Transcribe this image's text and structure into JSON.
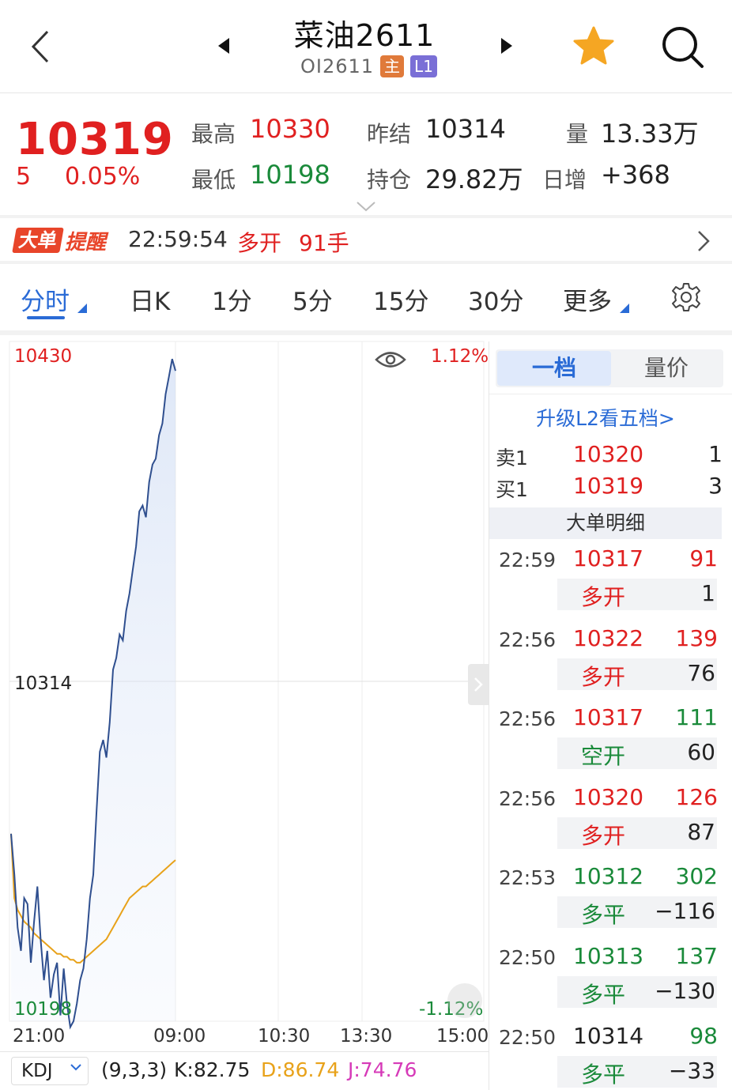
{
  "header": {
    "title": "菜油2611",
    "code": "OI2611",
    "badge_main": "主",
    "badge_level": "L1"
  },
  "quote": {
    "last": "10319",
    "change": "5",
    "change_pct": "0.05%",
    "high_label": "最高",
    "high": "10330",
    "low_label": "最低",
    "low": "10198",
    "prev_settle_label": "昨结",
    "prev_settle": "10314",
    "open_interest_label": "持仓",
    "open_interest": "29.82万",
    "volume_label": "量",
    "volume": "13.33万",
    "daily_inc_label": "日增",
    "daily_inc": "+368"
  },
  "alert": {
    "logo_big": "大单",
    "logo_remind": "提醒",
    "time": "22:59:54",
    "type": "多开",
    "qty": "91手"
  },
  "tabs": {
    "items": [
      "分时",
      "日K",
      "1分",
      "5分",
      "15分",
      "30分",
      "更多"
    ],
    "active": "分时"
  },
  "chart_data": {
    "type": "line",
    "y_top_label": "10430",
    "y_mid_label": "10314",
    "y_bottom_label": "10198",
    "pct_top": "1.12%",
    "pct_bottom": "-1.12%",
    "ylim": [
      10198,
      10430
    ],
    "x_labels": [
      "21:00",
      "09:00",
      "10:30",
      "13:30",
      "15:00"
    ],
    "series": [
      {
        "values": [
          10262,
          10248,
          10230,
          10222,
          10240,
          10238,
          10218,
          10232,
          10244,
          10226,
          10212,
          10222,
          10206,
          10214,
          10218,
          10200,
          10216,
          10204,
          10196,
          10198,
          10204,
          10212,
          10216,
          10226,
          10240,
          10248,
          10270,
          10290,
          10294,
          10288,
          10300,
          10318,
          10322,
          10330,
          10328,
          10338,
          10344,
          10352,
          10360,
          10372,
          10374,
          10370,
          10382,
          10388,
          10390,
          10398,
          10402,
          10412,
          10418,
          10424,
          10420
        ]
      },
      {
        "values": [
          10262,
          10240,
          10236,
          10234,
          10232,
          10231,
          10230,
          10228,
          10227,
          10226,
          10225,
          10224,
          10223,
          10222,
          10221,
          10221,
          10220,
          10220,
          10219,
          10219,
          10218,
          10218,
          10219,
          10220,
          10221,
          10222,
          10223,
          10224,
          10225,
          10226,
          10228,
          10230,
          10232,
          10234,
          10236,
          10238,
          10240,
          10241,
          10242,
          10243,
          10244,
          10244,
          10245,
          10246,
          10247,
          10248,
          10249,
          10250,
          10251,
          10252,
          10253
        ]
      }
    ]
  },
  "indicator": {
    "name": "KDJ",
    "params": "(9,3,3)",
    "k": "K:82.75",
    "d": "D:86.74",
    "j": "J:74.76",
    "colors": {
      "k": "#222222",
      "d": "#e8a21a",
      "j": "#d63ab8"
    }
  },
  "panel": {
    "seg_active": "一档",
    "seg_other": "量价",
    "upgrade": "升级L2看五档>",
    "ask_label": "卖1",
    "ask_price": "10320",
    "ask_vol": "1",
    "bid_label": "买1",
    "bid_price": "10319",
    "bid_vol": "3",
    "detail_title": "大单明细",
    "trades": [
      {
        "time": "22:59",
        "price": "10317",
        "price_color": "red",
        "vol": "91",
        "vol_color": "red",
        "type": "多开",
        "type_color": "red",
        "delta": "1"
      },
      {
        "time": "22:56",
        "price": "10322",
        "price_color": "red",
        "vol": "139",
        "vol_color": "red",
        "type": "多开",
        "type_color": "red",
        "delta": "76"
      },
      {
        "time": "22:56",
        "price": "10317",
        "price_color": "red",
        "vol": "111",
        "vol_color": "green",
        "type": "空开",
        "type_color": "green",
        "delta": "60"
      },
      {
        "time": "22:56",
        "price": "10320",
        "price_color": "red",
        "vol": "126",
        "vol_color": "red",
        "type": "多开",
        "type_color": "red",
        "delta": "87"
      },
      {
        "time": "22:53",
        "price": "10312",
        "price_color": "green",
        "vol": "302",
        "vol_color": "green",
        "type": "多平",
        "type_color": "green",
        "delta": "−116"
      },
      {
        "time": "22:50",
        "price": "10313",
        "price_color": "green",
        "vol": "137",
        "vol_color": "green",
        "type": "多平",
        "type_color": "green",
        "delta": "−130"
      },
      {
        "time": "22:50",
        "price": "10314",
        "price_color": "black",
        "vol": "98",
        "vol_color": "green",
        "type": "多平",
        "type_color": "green",
        "delta": "−33"
      }
    ]
  },
  "colors": {
    "up": "#e02020",
    "down": "#1a8a3a",
    "accent": "#2a6bd6",
    "price_line": "#2f4f8f",
    "avg_line": "#e8a21a"
  }
}
